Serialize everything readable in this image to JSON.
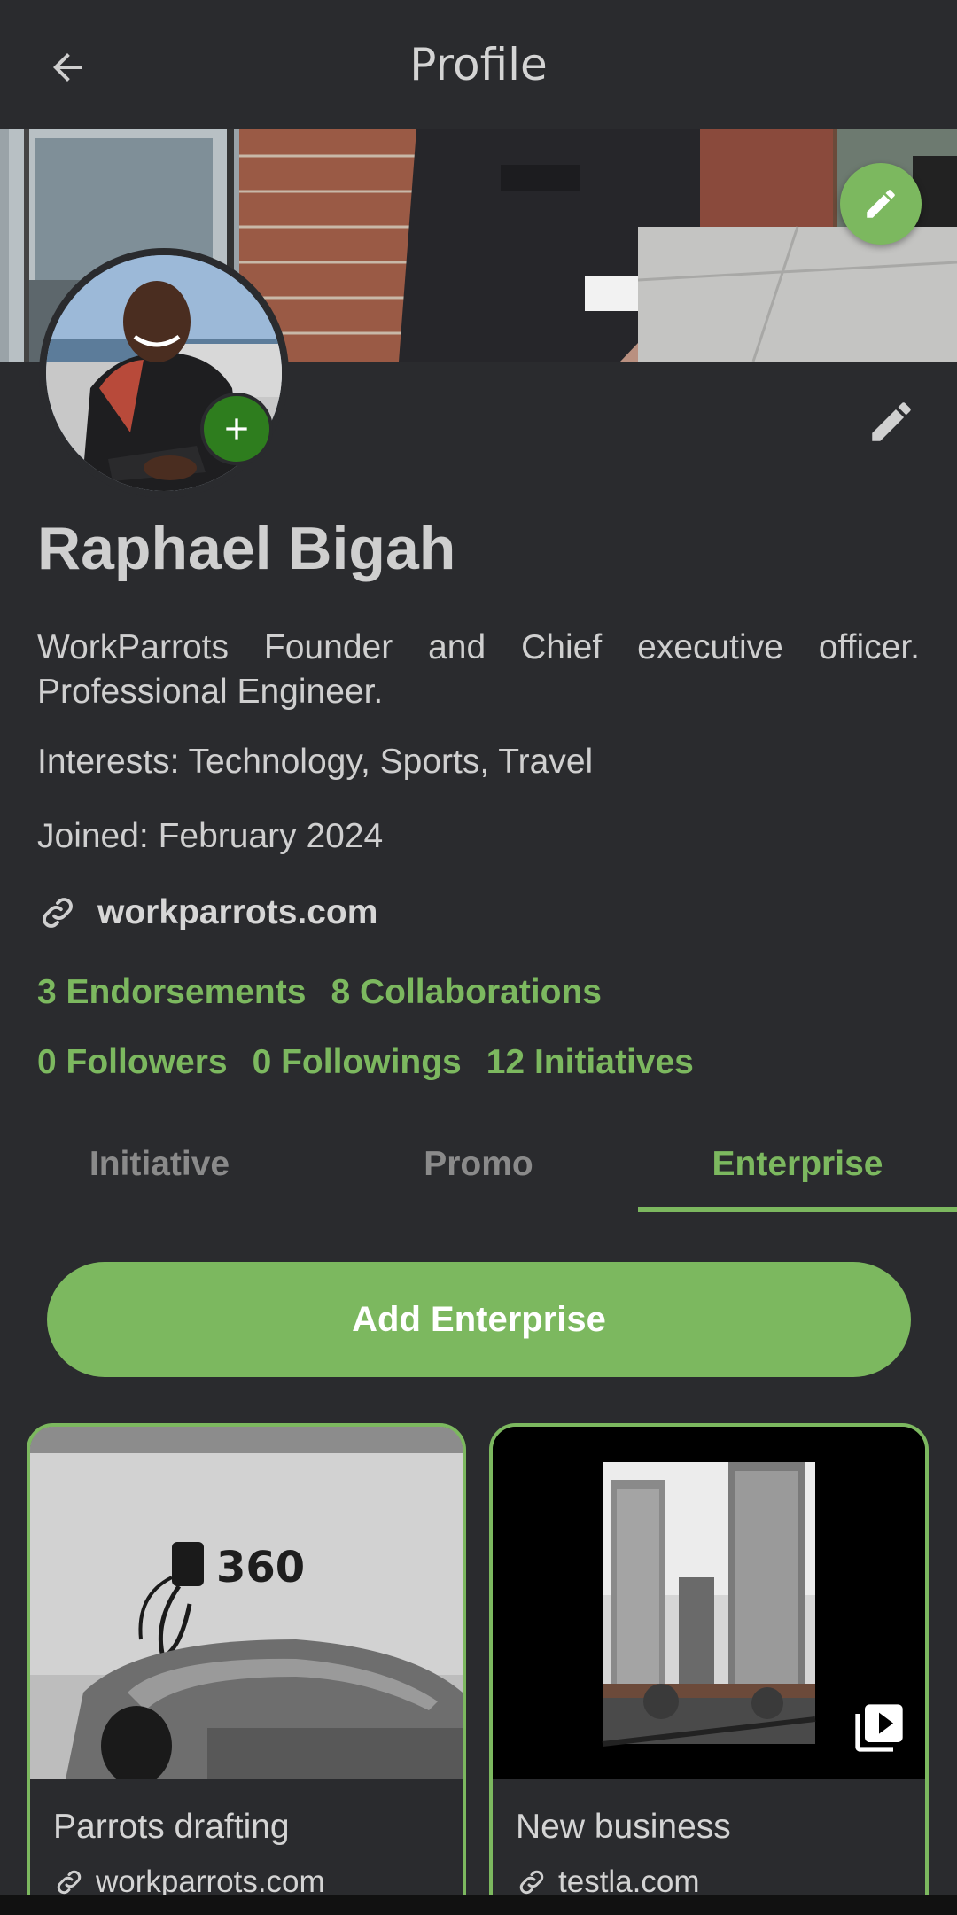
{
  "appbar": {
    "title": "Profile"
  },
  "profile": {
    "name": "Raphael Bigah",
    "bio": "WorkParrots Founder and Chief executive officer. Professional Engineer.",
    "interests": "Interests: Technology, Sports, Travel",
    "joined": "Joined: February 2024",
    "website": "workparrots.com"
  },
  "stats": {
    "endorsements": "3 Endorsements",
    "collaborations": "8 Collaborations",
    "followers": "0 Followers",
    "followings": "0 Followings",
    "initiatives": "12 Initiatives"
  },
  "tabs": [
    {
      "label": "Initiative",
      "active": false
    },
    {
      "label": "Promo",
      "active": false
    },
    {
      "label": "Enterprise",
      "active": true
    }
  ],
  "add_button": {
    "label": "Add Enterprise"
  },
  "cards": [
    {
      "title": "Parrots drafting",
      "link": "workparrots.com",
      "image": "parking-charger-photo"
    },
    {
      "title": "New business",
      "link": "testla.com",
      "image": "city-towers-video"
    }
  ],
  "icons": {
    "back": "arrow-left-icon",
    "cover_edit": "pencil-icon",
    "avatar_add": "plus-icon",
    "profile_edit": "pencil-icon",
    "link": "link-icon",
    "video": "video-library-icon"
  },
  "colors": {
    "background": "#2a2b2e",
    "accent": "#7cb85f",
    "avatar_add": "#2e7d1e",
    "text": "#cfcfcf",
    "tab_inactive": "#8a8a8a"
  }
}
